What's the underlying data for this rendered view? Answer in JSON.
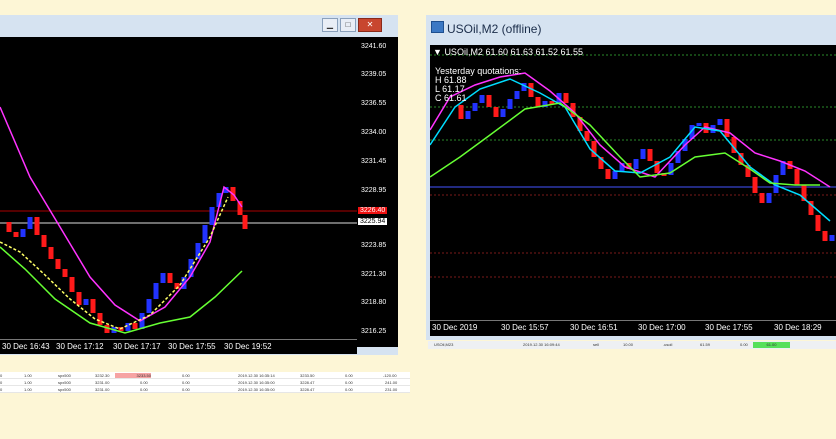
{
  "left_window": {
    "y_ticks": [
      "3241.60",
      "3239.05",
      "3236.55",
      "3234.00",
      "3231.45",
      "3228.95",
      "3226.40",
      "3223.85",
      "3221.30",
      "3218.80",
      "3216.25"
    ],
    "price_bid_label": "3226.40",
    "price_ask_label": "3225.94",
    "x_ticks": [
      "30 Dec 16:43",
      "30 Dec 17:12",
      "30 Dec 17:17",
      "30 Dec 17:55",
      "30 Dec 19:52"
    ],
    "buttons": {
      "minimize": "▁",
      "maximize": "□",
      "close": "✕"
    }
  },
  "right_window": {
    "title": "USOil,M2 (offline)",
    "header_text": "USOil,M2  61.60 61.63 61.52 61.55",
    "yesterday": {
      "label": "Yesterday quotations:",
      "high": "H 61.88",
      "low": "L 61.17",
      "close": "C 61.61"
    },
    "x_ticks": [
      "30 Dec 2019",
      "30 Dec 15:57",
      "30 Dec 16:51",
      "30 Dec 17:00",
      "30 Dec 17:55",
      "30 Dec 18:29"
    ]
  },
  "orders": {
    "rows": [
      [
        "0",
        "1.00",
        "spx500",
        "3232.30",
        "3233.50",
        "0.00",
        "2019.12.30 16:35:14",
        "3233.50",
        "0.00",
        "-120.00"
      ],
      [
        "0",
        "1.00",
        "spx500",
        "3231.00",
        "0.00",
        "0.00",
        "2019.12.30 16:35:00",
        "3228.47",
        "0.00",
        "241.00"
      ],
      [
        "0",
        "1.00",
        "spx500",
        "3231.00",
        "0.00",
        "0.00",
        "2019.12.30 16:35:00",
        "3228.47",
        "0.00",
        "231.00"
      ]
    ]
  },
  "status_bar": {
    "cells": [
      "USOil,M23",
      "2019.12.30 16:09:44",
      "sell",
      "10.00",
      ".usoil",
      "61.59",
      "0.00",
      "61.00"
    ]
  },
  "colors": {
    "bull": "#2233ff",
    "bear": "#ff1a1a",
    "ma_fast": "#ffff66",
    "ma_slow": "#ff33ff",
    "ma_green": "#66ff33",
    "cyan_ma": "#00ddff",
    "highlight_red": "#f6a3a3",
    "status_green": "#57e05a"
  }
}
